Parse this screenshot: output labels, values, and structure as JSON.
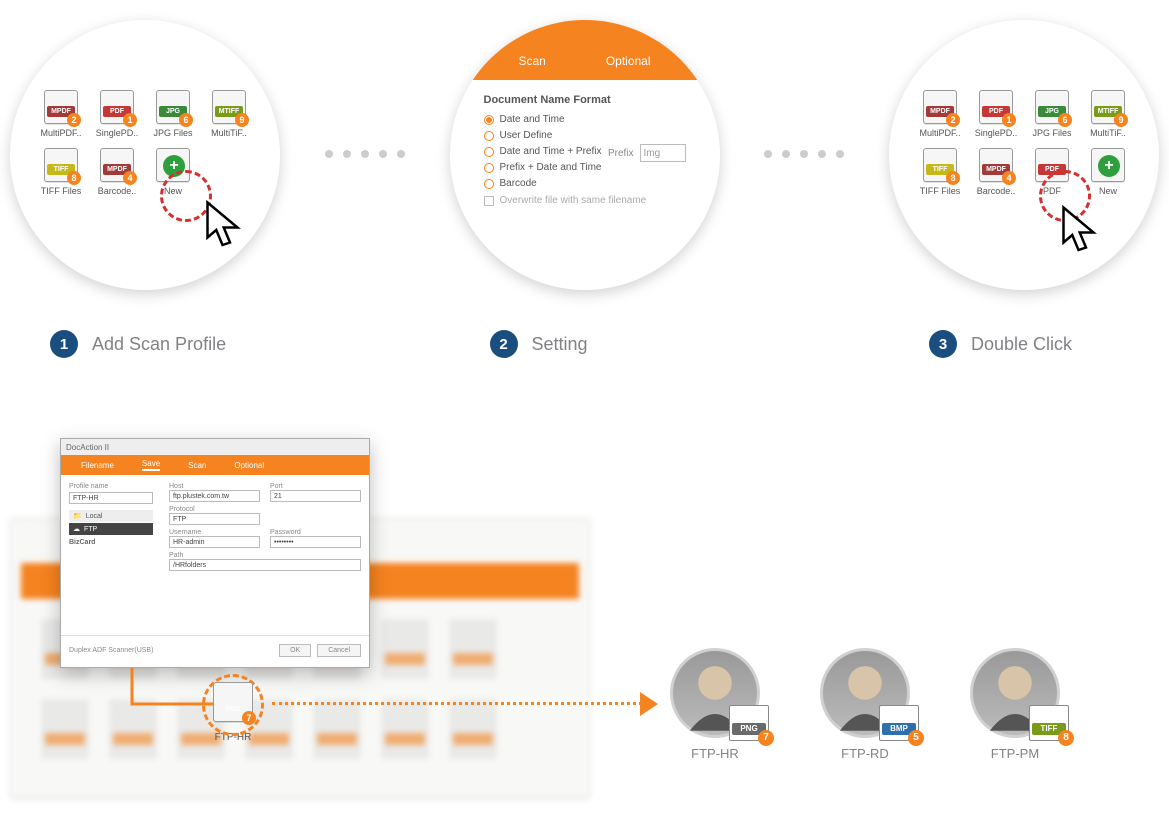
{
  "colors": {
    "accent": "#f5831f",
    "stepNum": "#1a4e7e",
    "dash": "#d62f2f"
  },
  "steps": [
    {
      "num": "1",
      "label": "Add Scan Profile"
    },
    {
      "num": "2",
      "label": "Setting"
    },
    {
      "num": "3",
      "label": "Double Click"
    }
  ],
  "step1_profiles": [
    {
      "label": "MultiPDF..",
      "badge": "MPDF",
      "badgeColor": "#a33a3a",
      "num": "2"
    },
    {
      "label": "SinglePD..",
      "badge": "PDF",
      "badgeColor": "#c53838",
      "num": "1"
    },
    {
      "label": "JPG Files",
      "badge": "JPG",
      "badgeColor": "#3a8a3a",
      "num": "6"
    },
    {
      "label": "MultiTiF..",
      "badge": "MTIFF",
      "badgeColor": "#7a9a1a",
      "num": "9"
    },
    {
      "label": "TIFF Files",
      "badge": "TIFF",
      "badgeColor": "#c7b81a",
      "num": "8"
    },
    {
      "label": "Barcode..",
      "badge": "MPDF",
      "badgeColor": "#a33a3a",
      "num": "4"
    },
    {
      "label": "New",
      "badge": "",
      "badgeColor": "",
      "num": "",
      "isNew": true
    }
  ],
  "step3_profiles": [
    {
      "label": "MultiPDF..",
      "badge": "MPDF",
      "badgeColor": "#a33a3a",
      "num": "2"
    },
    {
      "label": "SinglePD..",
      "badge": "PDF",
      "badgeColor": "#c53838",
      "num": "1"
    },
    {
      "label": "JPG Files",
      "badge": "JPG",
      "badgeColor": "#3a8a3a",
      "num": "6"
    },
    {
      "label": "MultiTiF..",
      "badge": "MTIFF",
      "badgeColor": "#7a9a1a",
      "num": "9"
    },
    {
      "label": "TIFF Files",
      "badge": "TIFF",
      "badgeColor": "#c7b81a",
      "num": "8"
    },
    {
      "label": "Barcode..",
      "badge": "MPDF",
      "badgeColor": "#a33a3a",
      "num": "4"
    },
    {
      "label": "PDF",
      "badge": "PDF",
      "badgeColor": "#c53838",
      "num": ""
    },
    {
      "label": "New",
      "badge": "",
      "badgeColor": "",
      "num": "",
      "isNew": true
    }
  ],
  "settings": {
    "tabScan": "Scan",
    "tabOptional": "Optional",
    "title": "Document Name Format",
    "options": [
      "Date and Time",
      "User Define",
      "Date and Time + Prefix",
      "Prefix + Date and Time",
      "Barcode"
    ],
    "selected": 0,
    "prefixLabel": "Prefix",
    "prefixValue": "Img",
    "overwrite": "Overwrite file with same filename"
  },
  "dialog": {
    "title": "DocAction II",
    "tabs": [
      "Filename",
      "Save",
      "Scan",
      "Optional"
    ],
    "activeTab": 1,
    "left": {
      "profileNameLabel": "Profile name",
      "profileNameValue": "FTP-HR",
      "local": "Local",
      "ftp": "FTP",
      "bizcard": "BizCard"
    },
    "right": {
      "hostLabel": "Host",
      "hostValue": "ftp.plustek.com.tw",
      "portLabel": "Port",
      "portValue": "21",
      "protocolLabel": "Protocol",
      "protocolValue": "FTP",
      "usernameLabel": "Username",
      "usernameValue": "HR-admin",
      "passwordLabel": "Password",
      "passwordValue": "••••••••",
      "pathLabel": "Path",
      "pathValue": "/HRfolders"
    },
    "scanner": "Duplex ADF Scanner(USB)",
    "ok": "OK",
    "cancel": "Cancel"
  },
  "pngNode": {
    "badge": "PNG",
    "badgeColor": "#6a6a6a",
    "num": "7",
    "label": "FTP-HR"
  },
  "people": [
    {
      "label": "FTP-HR",
      "badge": "PNG",
      "badgeColor": "#6a6a6a",
      "num": "7"
    },
    {
      "label": "FTP-RD",
      "badge": "BMP",
      "badgeColor": "#2e6fae",
      "num": "5"
    },
    {
      "label": "FTP-PM",
      "badge": "TIFF",
      "badgeColor": "#7a9a1a",
      "num": "8"
    }
  ]
}
